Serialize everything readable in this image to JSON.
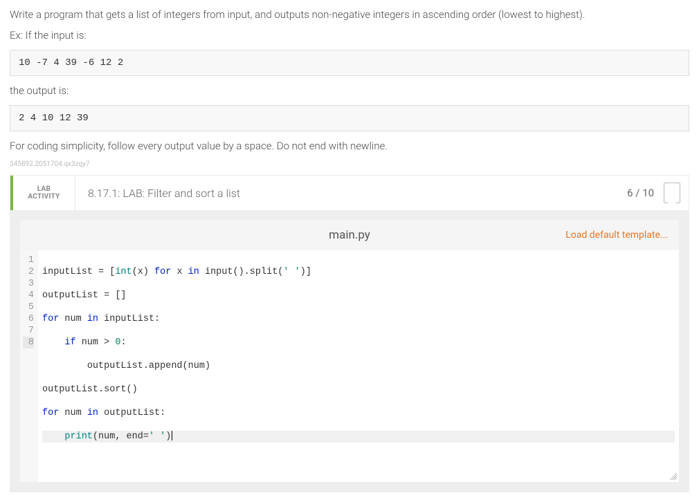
{
  "instructions": {
    "p1": "Write a program that gets a list of integers from input, and outputs non-negative integers in ascending order (lowest to highest).",
    "p2": "Ex: If the input is:",
    "code1": "10 -7 4 39 -6 12 2",
    "p3": "the output is:",
    "code2": "2 4 10 12 39",
    "p4": "For coding simplicity, follow every output value by a space. Do not end with newline.",
    "sig": "345892.2051704.qx3zqy7"
  },
  "lab": {
    "activity_label_line1": "LAB",
    "activity_label_line2": "ACTIVITY",
    "title": "8.17.1: LAB: Filter and sort a list",
    "score": "6 / 10"
  },
  "editor": {
    "filename": "main.py",
    "load_default": "Load default template...",
    "line_count": 8,
    "highlight_line": 8,
    "code": {
      "l1": {
        "a": "inputList = [",
        "b": "int",
        "c": "(x) ",
        "d": "for",
        "e": " x ",
        "f": "in",
        "g": " input().split(",
        "h": "' '",
        "i": ")]"
      },
      "l2": "outputList = []",
      "l3": {
        "a": "for",
        "b": " num ",
        "c": "in",
        "d": " inputList:"
      },
      "l4": {
        "indent": "    ",
        "a": "if",
        "b": " num > ",
        "c": "0",
        "d": ":"
      },
      "l5": {
        "indent": "        ",
        "a": "outputList.append(num)"
      },
      "l6": "outputList.sort()",
      "l7": {
        "a": "for",
        "b": " num ",
        "c": "in",
        "d": " outputList:"
      },
      "l8": {
        "indent": "    ",
        "a": "print",
        "b": "(num, end=",
        "c": "' '",
        "d": ")"
      }
    }
  }
}
